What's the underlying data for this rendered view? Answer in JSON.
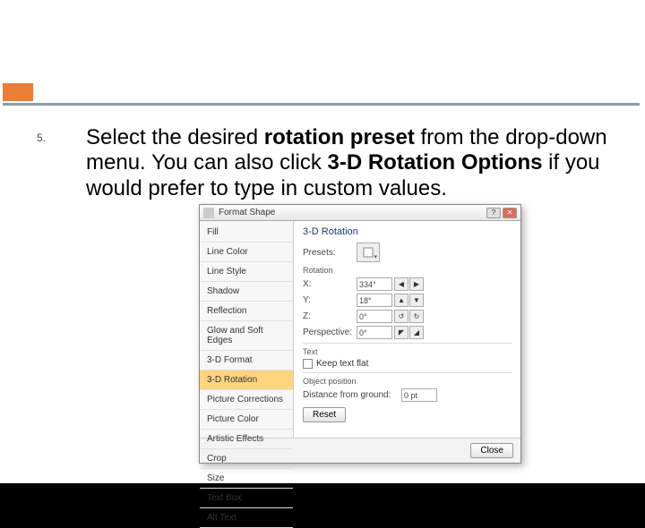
{
  "list_number": "5.",
  "body": {
    "t1": "Select the desired ",
    "b1": "rotation preset",
    "t2": " from the drop-down menu. You can also click ",
    "b2": "3-D Rotation Options",
    "t3": " if you would prefer to type in custom values.",
    "t3_visible": " if you would prefer to type in custom valu"
  },
  "dialog": {
    "title": "Format Shape",
    "sidebar": [
      "Fill",
      "Line Color",
      "Line Style",
      "Shadow",
      "Reflection",
      "Glow and Soft Edges",
      "3-D Format",
      "3-D Rotation",
      "Picture Corrections",
      "Picture Color",
      "Artistic Effects",
      "Crop",
      "Size",
      "Text Box",
      "Alt Text"
    ],
    "active_index": 7,
    "panel": {
      "heading": "3-D Rotation",
      "presets_lbl": "Presets:",
      "rotation_lbl": "Rotation",
      "axes": [
        {
          "name": "X:",
          "value": "334°"
        },
        {
          "name": "Y:",
          "value": "18°"
        },
        {
          "name": "Z:",
          "value": "0°"
        }
      ],
      "perspective_lbl": "Perspective:",
      "perspective_val": "0°",
      "text_section": "Text",
      "keep_flat": "Keep text flat",
      "objpos_section": "Object position",
      "distance_lbl": "Distance from ground:",
      "distance_val": "0 pt",
      "reset": "Reset",
      "close": "Close"
    }
  }
}
